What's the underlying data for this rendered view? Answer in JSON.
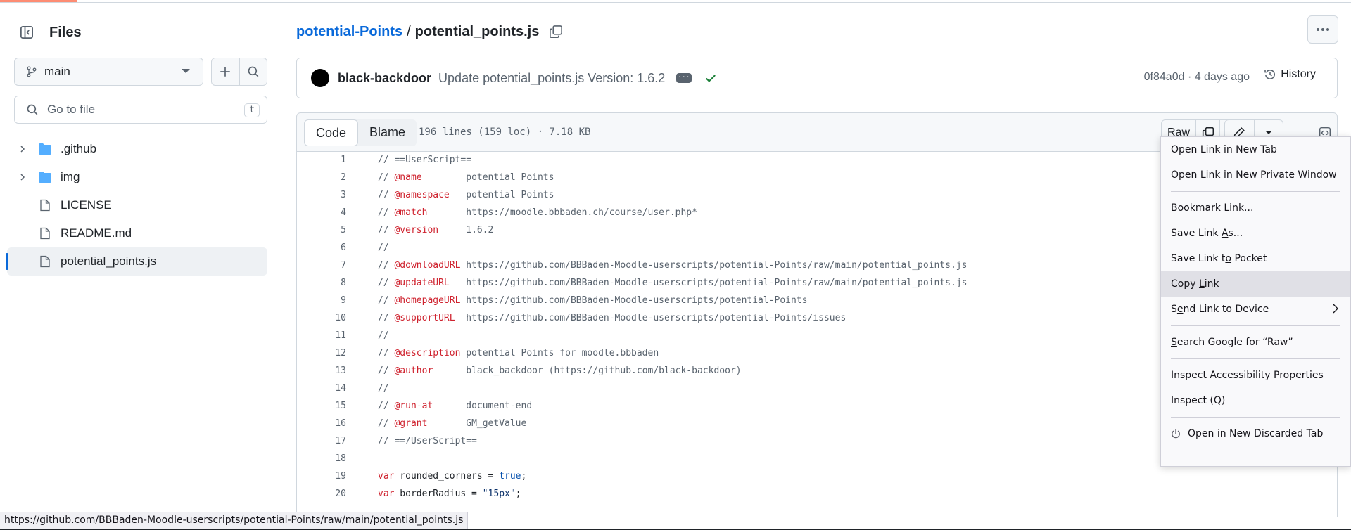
{
  "sidebar": {
    "title": "Files",
    "branch": "main",
    "goto_placeholder": "Go to file",
    "goto_shortcut": "t",
    "tree": [
      {
        "label": ".github",
        "type": "folder"
      },
      {
        "label": "img",
        "type": "folder"
      },
      {
        "label": "LICENSE",
        "type": "file"
      },
      {
        "label": "README.md",
        "type": "file"
      },
      {
        "label": "potential_points.js",
        "type": "file",
        "selected": true
      }
    ]
  },
  "breadcrumb": {
    "repo": "potential-Points",
    "separator": "/",
    "file": "potential_points.js"
  },
  "commit": {
    "author": "black-backdoor",
    "message": "Update potential_points.js Version: 1.6.2",
    "sha_time": "0f84a0d · 4 days ago",
    "history_label": "History"
  },
  "file_header": {
    "tabs": [
      "Code",
      "Blame"
    ],
    "active_tab": "Code",
    "meta": "196 lines (159 loc) · 7.18 KB",
    "raw_label": "Raw"
  },
  "code_lines": [
    {
      "n": "1",
      "parts": [
        [
          "cm",
          "// ==UserScript=="
        ]
      ]
    },
    {
      "n": "2",
      "parts": [
        [
          "cm",
          "// "
        ],
        [
          "tag",
          "@name"
        ],
        [
          "cm",
          "        potential Points"
        ]
      ]
    },
    {
      "n": "3",
      "parts": [
        [
          "cm",
          "// "
        ],
        [
          "tag",
          "@namespace"
        ],
        [
          "cm",
          "   potential Points"
        ]
      ]
    },
    {
      "n": "4",
      "parts": [
        [
          "cm",
          "// "
        ],
        [
          "tag",
          "@match"
        ],
        [
          "cm",
          "       https://moodle.bbbaden.ch/course/user.php*"
        ]
      ]
    },
    {
      "n": "5",
      "parts": [
        [
          "cm",
          "// "
        ],
        [
          "tag",
          "@version"
        ],
        [
          "cm",
          "     1.6.2"
        ]
      ]
    },
    {
      "n": "6",
      "parts": [
        [
          "cm",
          "//"
        ]
      ]
    },
    {
      "n": "7",
      "parts": [
        [
          "cm",
          "// "
        ],
        [
          "tag",
          "@downloadURL"
        ],
        [
          "cm",
          " https://github.com/BBBaden-Moodle-userscripts/potential-Points/raw/main/potential_points.js"
        ]
      ]
    },
    {
      "n": "8",
      "parts": [
        [
          "cm",
          "// "
        ],
        [
          "tag",
          "@updateURL"
        ],
        [
          "cm",
          "   https://github.com/BBBaden-Moodle-userscripts/potential-Points/raw/main/potential_points.js"
        ]
      ]
    },
    {
      "n": "9",
      "parts": [
        [
          "cm",
          "// "
        ],
        [
          "tag",
          "@homepageURL"
        ],
        [
          "cm",
          " https://github.com/BBBaden-Moodle-userscripts/potential-Points"
        ]
      ]
    },
    {
      "n": "10",
      "parts": [
        [
          "cm",
          "// "
        ],
        [
          "tag",
          "@supportURL"
        ],
        [
          "cm",
          "  https://github.com/BBBaden-Moodle-userscripts/potential-Points/issues"
        ]
      ]
    },
    {
      "n": "11",
      "parts": [
        [
          "cm",
          "//"
        ]
      ]
    },
    {
      "n": "12",
      "parts": [
        [
          "cm",
          "// "
        ],
        [
          "tag",
          "@description"
        ],
        [
          "cm",
          " potential Points for moodle.bbbaden"
        ]
      ]
    },
    {
      "n": "13",
      "parts": [
        [
          "cm",
          "// "
        ],
        [
          "tag",
          "@author"
        ],
        [
          "cm",
          "      black_backdoor (https://github.com/black-backdoor)"
        ]
      ]
    },
    {
      "n": "14",
      "parts": [
        [
          "cm",
          "//"
        ]
      ]
    },
    {
      "n": "15",
      "parts": [
        [
          "cm",
          "// "
        ],
        [
          "tag",
          "@run-at"
        ],
        [
          "cm",
          "      document-end"
        ]
      ]
    },
    {
      "n": "16",
      "parts": [
        [
          "cm",
          "// "
        ],
        [
          "tag",
          "@grant"
        ],
        [
          "cm",
          "       GM_getValue"
        ]
      ]
    },
    {
      "n": "17",
      "parts": [
        [
          "cm",
          "// ==/UserScript=="
        ]
      ]
    },
    {
      "n": "18",
      "parts": []
    },
    {
      "n": "19",
      "parts": [
        [
          "kw",
          "var"
        ],
        [
          "pl",
          " rounded_corners = "
        ],
        [
          "bool",
          "true"
        ],
        [
          "pl",
          ";"
        ]
      ]
    },
    {
      "n": "20",
      "parts": [
        [
          "kw",
          "var"
        ],
        [
          "pl",
          " borderRadius = "
        ],
        [
          "str",
          "\"15px\""
        ],
        [
          "pl",
          ";"
        ]
      ]
    }
  ],
  "context_menu": [
    {
      "label": "Open Link in New Tab",
      "ul": 20
    },
    {
      "label": "Open Link in New Private Window",
      "ul": 23
    },
    {
      "sep": true
    },
    {
      "label": "Bookmark Link...",
      "ul": 0
    },
    {
      "label": "Save Link As...",
      "ul": 10
    },
    {
      "label": "Save Link to Pocket",
      "ul": 11
    },
    {
      "label": "Copy Link",
      "ul": 5,
      "hover": true
    },
    {
      "label": "Send Link to Device",
      "ul": 1,
      "submenu": true
    },
    {
      "sep": true
    },
    {
      "label": "Search Google for “Raw”",
      "ul": 0
    },
    {
      "sep": true
    },
    {
      "label": "Inspect Accessibility Properties",
      "ul": -1
    },
    {
      "label": "Inspect (Q)",
      "ul": -1
    },
    {
      "sep": true
    },
    {
      "label": "Open in New Discarded Tab",
      "ul": -1,
      "icon": "power-icon"
    }
  ],
  "status_url": "https://github.com/BBBaden-Moodle-userscripts/potential-Points/raw/main/potential_points.js",
  "colors": {
    "link": "#0969da",
    "check": "#1a7f37",
    "keyword": "#cf222e"
  }
}
